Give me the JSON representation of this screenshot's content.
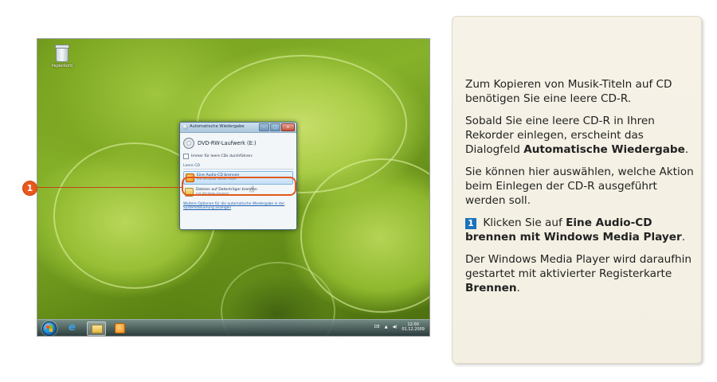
{
  "desktop": {
    "recycle_bin_label": "Papierkorb",
    "dialog": {
      "title": "Automatische Wiedergabe",
      "minimize_label": "–",
      "maximize_label": "□",
      "close_label": "x",
      "drive_name": "DVD-RW-Laufwerk (E:)",
      "always_checkbox_label": "Immer für leere CDs durchführen:",
      "section_label": "Leere CD",
      "options": [
        {
          "title": "Eine Audio-CD brennen",
          "subtitle": "mit Windows Media Player"
        },
        {
          "title": "Dateien auf Datenträger brennen",
          "subtitle": "mit Windows-Explorer"
        }
      ],
      "more_options_link": "Weitere Optionen für die automatische Wiedergabe in der Systemsteuerung anzeigen"
    },
    "taskbar": {
      "language": "DE",
      "time": "12:00",
      "date": "01.12.2009"
    }
  },
  "callout": {
    "number": "1"
  },
  "panel": {
    "p1": "Zum Kopieren von Musik-Titeln auf CD benötigen Sie eine leere CD-R.",
    "p2_text": "Sobald Sie eine leere CD-R in Ihren Rekorder einlegen, erscheint das Dialogfeld ",
    "p2_bold": "Automatische Wiedergabe",
    "p2_end": ".",
    "p3": "Sie können hier auswählen, welche Aktion beim Einlegen der CD-R ausgeführt werden soll.",
    "step_number": "1",
    "p4_text": " Klicken Sie auf ",
    "p4_bold": "Eine Audio-CD brennen mit Windows Media Player",
    "p4_end": ".",
    "p5_text": "Der Windows Media Player wird daraufhin gestartet mit aktivierter Registerkarte ",
    "p5_bold": "Brennen",
    "p5_end": "."
  },
  "colors": {
    "accent_orange": "#e8571c",
    "step_blue": "#1d73b9",
    "panel_bg": "#f6f2e7"
  }
}
